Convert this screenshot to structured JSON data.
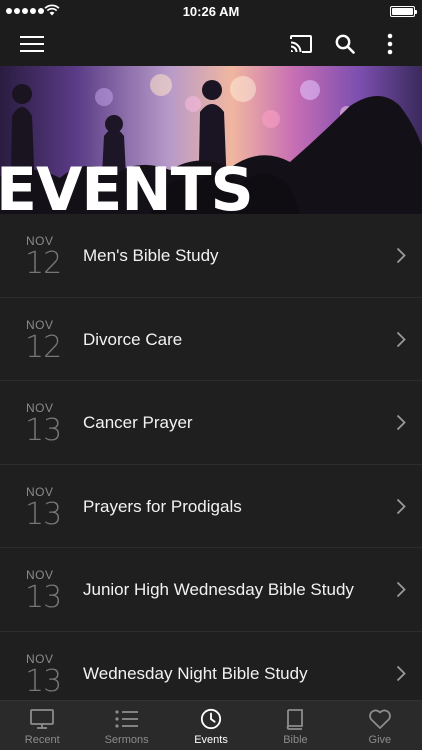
{
  "status_bar": {
    "time": "10:26 AM"
  },
  "hero": {
    "title": "EVENTS"
  },
  "events": [
    {
      "month": "NOV",
      "day": "12",
      "title": "Men's Bible Study"
    },
    {
      "month": "NOV",
      "day": "12",
      "title": "Divorce Care"
    },
    {
      "month": "NOV",
      "day": "13",
      "title": "Cancer Prayer"
    },
    {
      "month": "NOV",
      "day": "13",
      "title": "Prayers for Prodigals"
    },
    {
      "month": "NOV",
      "day": "13",
      "title": "Junior High Wednesday Bible Study"
    },
    {
      "month": "NOV",
      "day": "13",
      "title": "Wednesday Night Bible Study"
    }
  ],
  "tabs": [
    {
      "label": "Recent",
      "icon": "monitor-icon",
      "active": false
    },
    {
      "label": "Sermons",
      "icon": "list-icon",
      "active": false
    },
    {
      "label": "Events",
      "icon": "clock-icon",
      "active": true
    },
    {
      "label": "Bible",
      "icon": "book-icon",
      "active": false
    },
    {
      "label": "Give",
      "icon": "heart-icon",
      "active": false
    }
  ],
  "colors": {
    "background": "#1f1f1f",
    "bar": "#1c1c1c",
    "tab_bar": "#2a2a2a",
    "muted_text": "#8a8a8a"
  }
}
